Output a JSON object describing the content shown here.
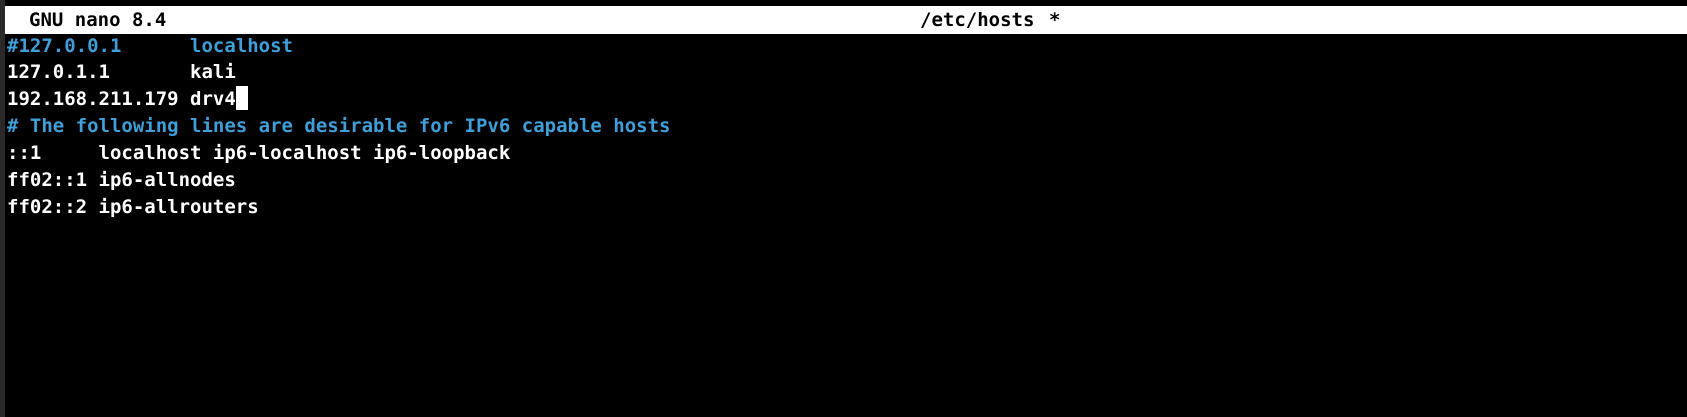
{
  "titlebar": {
    "app_version": "GNU nano 8.4",
    "filename": "/etc/hosts",
    "modified_marker": "*"
  },
  "editor": {
    "lines": [
      {
        "text": "#127.0.0.1      localhost",
        "kind": "comment"
      },
      {
        "text": "127.0.1.1       kali",
        "kind": "normal"
      },
      {
        "text": "192.168.211.179 drv4",
        "kind": "normal",
        "has_cursor": true
      },
      {
        "text": "# The following lines are desirable for IPv6 capable hosts",
        "kind": "comment"
      },
      {
        "text": "::1     localhost ip6-localhost ip6-loopback",
        "kind": "normal"
      },
      {
        "text": "ff02::1 ip6-allnodes",
        "kind": "normal"
      },
      {
        "text": "ff02::2 ip6-allrouters",
        "kind": "normal"
      }
    ]
  },
  "colors": {
    "background": "#000000",
    "text": "#ffffff",
    "comment": "#3f9fd8",
    "titlebar_bg": "#ffffff",
    "titlebar_text": "#000000"
  }
}
